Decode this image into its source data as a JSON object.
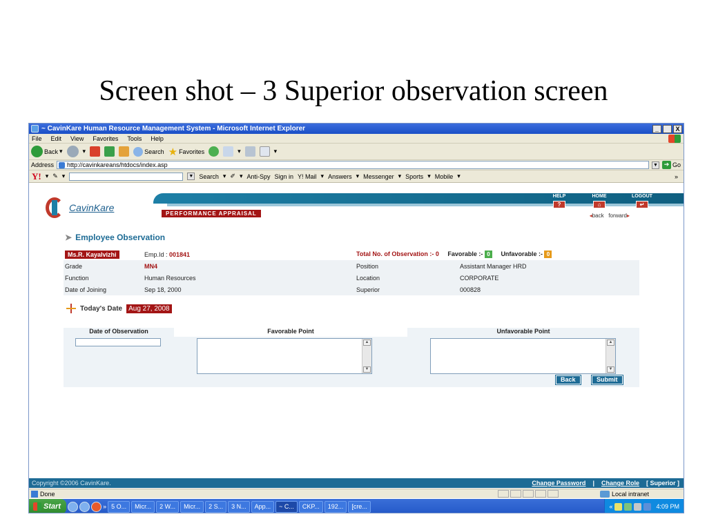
{
  "slide": {
    "title": "Screen shot – 3 Superior observation screen"
  },
  "browser": {
    "window_title": "~ CavinKare Human Resource Management System - Microsoft Internet Explorer",
    "win_min": "_",
    "win_max": " ",
    "win_close": "X",
    "menu": [
      "File",
      "Edit",
      "View",
      "Favorites",
      "Tools",
      "Help"
    ],
    "toolbar": {
      "back": "Back",
      "search": "Search",
      "favorites": "Favorites"
    },
    "address_label": "Address",
    "address_url": "http://cavinkareans/htdocs/index.asp",
    "go": "Go",
    "yahoo": {
      "logo": "Y!",
      "search": "Search",
      "antispy": "Anti-Spy",
      "signin": "Sign in",
      "mail": "Y! Mail",
      "answers": "Answers",
      "messenger": "Messenger",
      "sports": "Sports",
      "mobile": "Mobile",
      "more": "»"
    }
  },
  "app": {
    "logo_text": "CavinKare",
    "section_label": "PERFORMANCE APPRAISAL",
    "top_links": {
      "help": "HELP",
      "home": "HOME",
      "logout": "LOGOUT"
    },
    "nav": {
      "back": "back",
      "forward": "forward"
    },
    "page_heading": "Employee Observation",
    "employee": {
      "name": "Ms.R. Kayalvizhi",
      "emp_id_label": "Emp.Id :",
      "emp_id": "001841",
      "total_label": "Total No. of Observation :-",
      "total": "0",
      "favorable_label": "Favorable :-",
      "favorable": "0",
      "unfavorable_label": "Unfavorable :-",
      "unfavorable": "0"
    },
    "details": [
      {
        "l1": "Grade",
        "v1": "MN4",
        "l2": "Position",
        "v2": "Assistant Manager HRD"
      },
      {
        "l1": "Function",
        "v1": "Human Resources",
        "l2": "Location",
        "v2": "CORPORATE"
      },
      {
        "l1": "Date of Joining",
        "v1": "Sep 18, 2000",
        "l2": "Superior",
        "v2": "000828"
      }
    ],
    "today_label": "Today's Date",
    "today_value": "Aug 27, 2008",
    "form": {
      "col_date": "Date of Observation",
      "col_fav": "Favorable Point",
      "col_unfav": "Unfavorable Point",
      "back_button": "Back",
      "submit_button": "Submit"
    },
    "footer": {
      "copyright": "Copyright ©2006 CavinKare.",
      "change_password": "Change Password",
      "separator": "|",
      "change_role": "Change Role",
      "role": "[ Superior ]"
    }
  },
  "status": {
    "text": "Done",
    "zone": "Local intranet"
  },
  "taskbar": {
    "start": "Start",
    "tasks": [
      "5 O...",
      "Micr...",
      "2 W...",
      "Micr...",
      "2 S...",
      "3 N...",
      "App...",
      "~ C...",
      "CKP...",
      "192...",
      "[cre..."
    ],
    "active_task": 7,
    "time": "4:09 PM"
  }
}
